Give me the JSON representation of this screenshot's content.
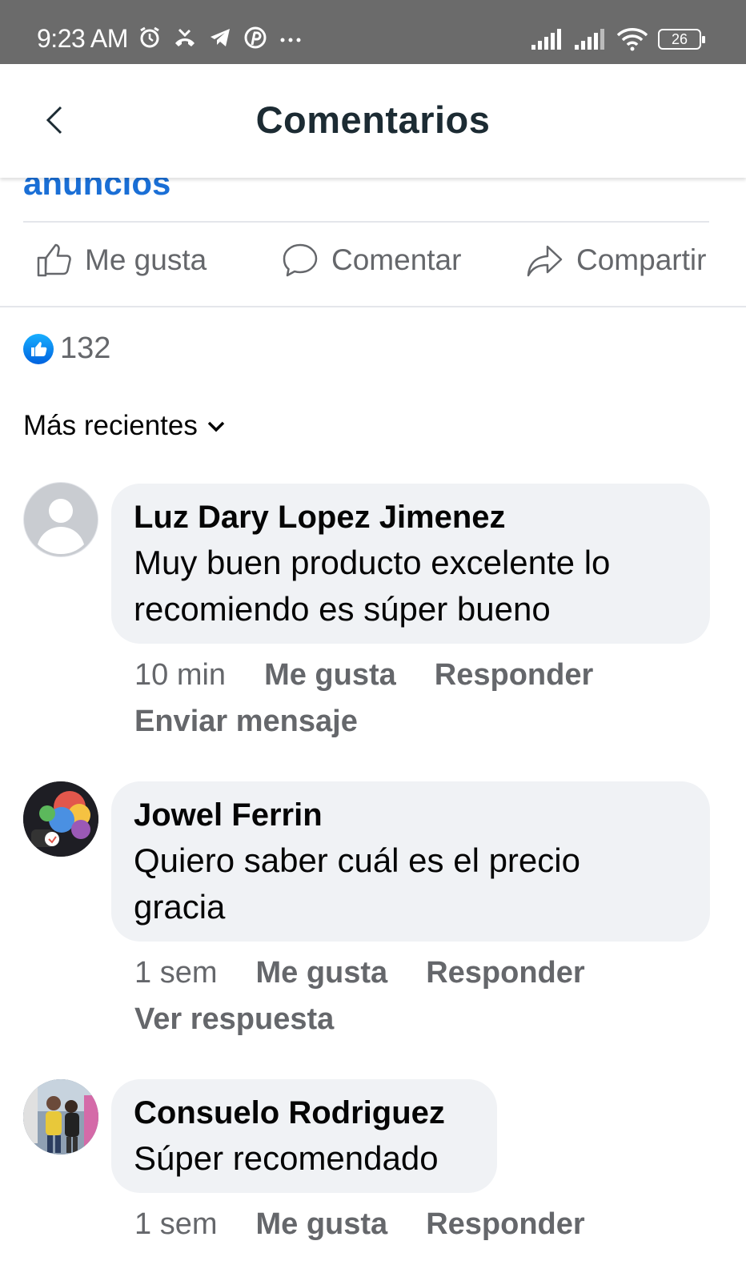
{
  "status_bar": {
    "time": "9:23 AM",
    "left_icons": [
      "alarm-icon",
      "missed-call-icon",
      "telegram-icon",
      "pinterest-icon",
      "more-dots-icon"
    ],
    "right_icons": [
      "signal-icon",
      "signal-icon",
      "wifi-icon"
    ],
    "battery": "26"
  },
  "header": {
    "title": "Comentarios",
    "back_icon": "chevron-left-icon"
  },
  "post": {
    "ads_link": "anuncios",
    "actions": {
      "like": "Me gusta",
      "comment": "Comentar",
      "share": "Compartir"
    },
    "reaction_count": "132"
  },
  "sort": {
    "label": "Más recientes"
  },
  "comments": [
    {
      "author": "Luz Dary Lopez Jimenez",
      "text_line1": "Muy buen producto excelente lo",
      "text_line2": "recomiendo es súper bueno",
      "time": "10 min",
      "like": "Me gusta",
      "reply": "Responder",
      "extra": "Enviar mensaje"
    },
    {
      "author": "Jowel Ferrin",
      "text_line1": "Quiero saber cuál es el precio",
      "text_line2": "gracia",
      "time": "1 sem",
      "like": "Me gusta",
      "reply": "Responder",
      "extra": "Ver respuesta"
    },
    {
      "author": "Consuelo Rodriguez",
      "text_line1": "Súper recomendado",
      "time": "1 sem",
      "like": "Me gusta",
      "reply": "Responder"
    }
  ],
  "colors": {
    "status_bar": "#6b6b6b",
    "link_blue": "#1a6fd6",
    "like_blue": "#1877f2",
    "bubble": "#f0f2f5",
    "secondary_text": "#65676b"
  }
}
